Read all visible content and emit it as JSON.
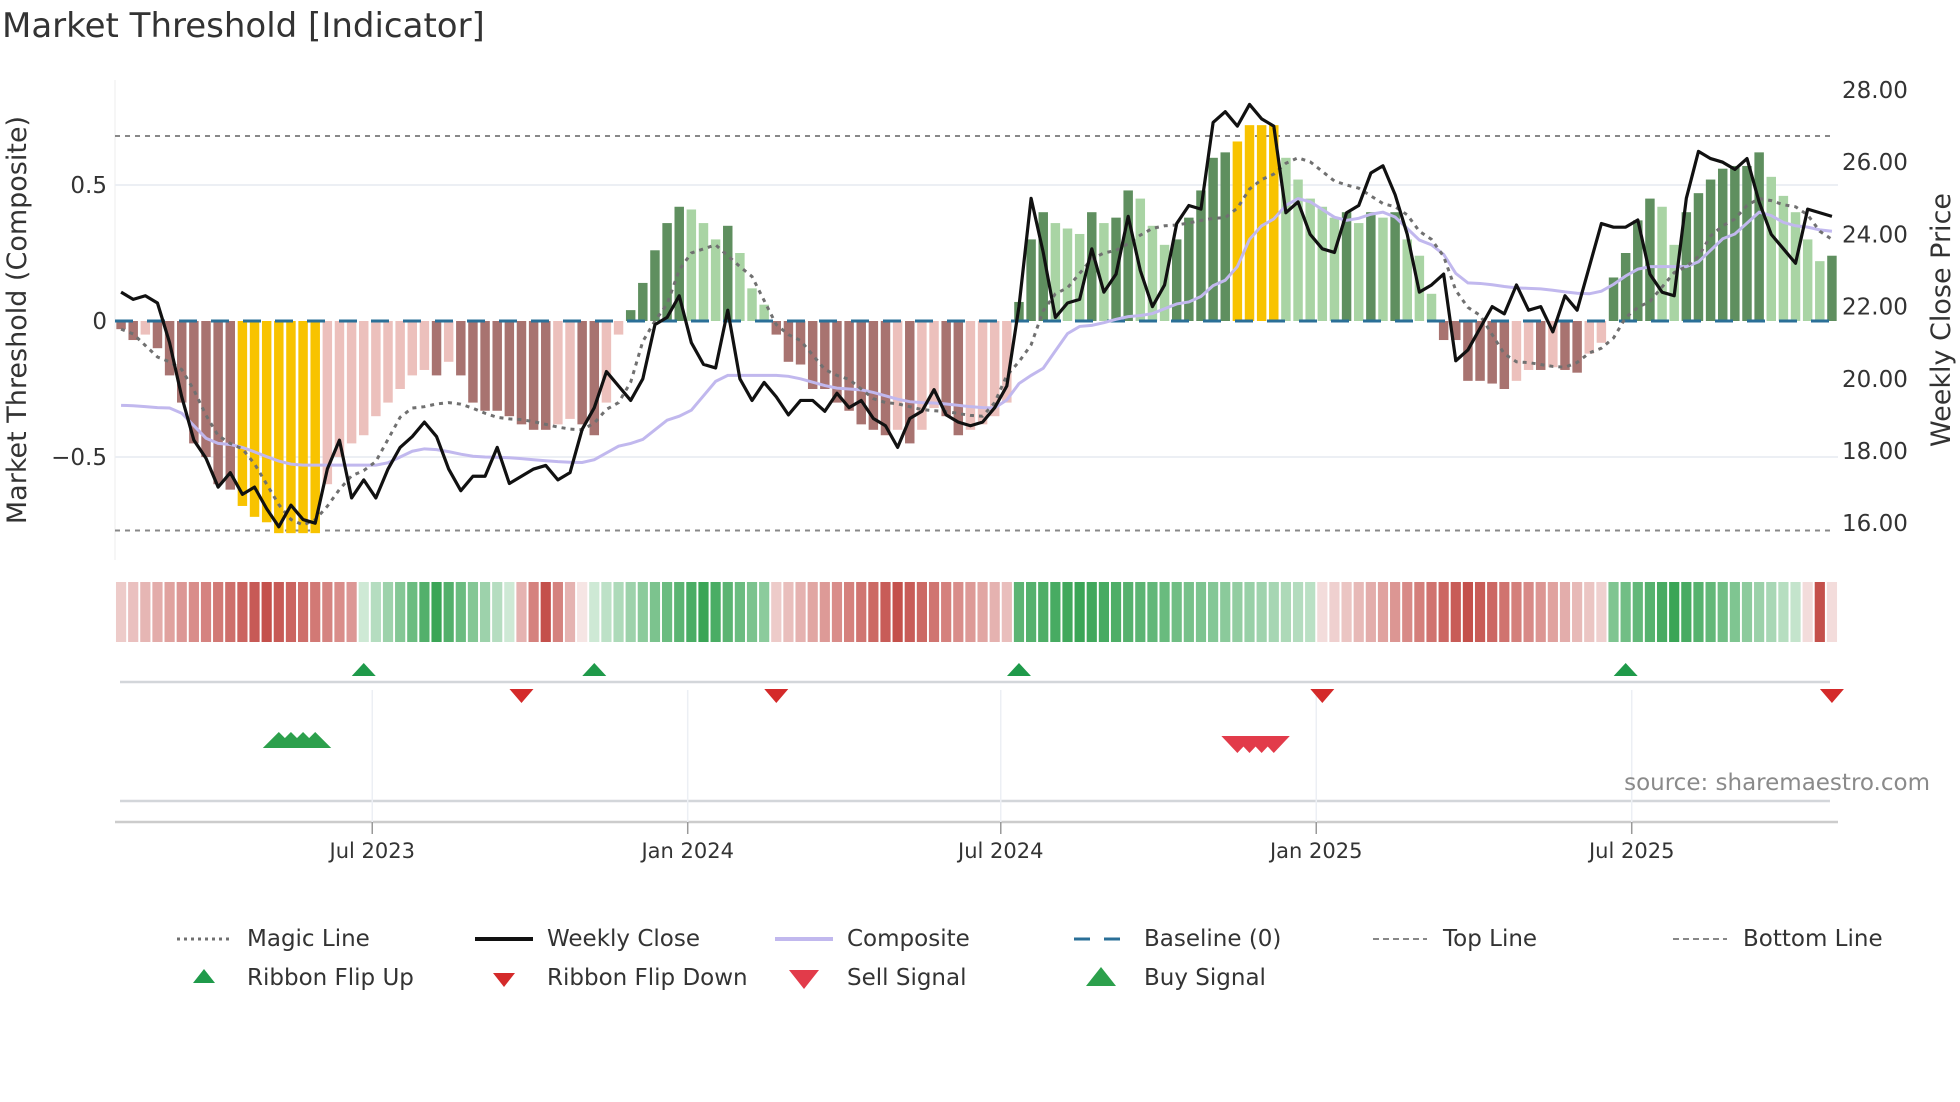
{
  "title": "Market Threshold [Indicator]",
  "source": "source: sharemaestro.com",
  "chart_data": {
    "type": "bar+line",
    "title": "Market Threshold [Indicator]",
    "ylabel_left": "Market Threshold (Composite)",
    "ylabel_right": "Weekly Close Price",
    "ylim_left": [
      -0.85,
      0.85
    ],
    "ylim_right": [
      14.9,
      29.2
    ],
    "left_ticks": [
      {
        "v": 0.5,
        "label": "0.5"
      },
      {
        "v": 0,
        "label": "0"
      },
      {
        "v": -0.5,
        "label": "−0.5"
      }
    ],
    "right_ticks": [
      {
        "v": 28,
        "label": "28.00"
      },
      {
        "v": 26,
        "label": "26.00"
      },
      {
        "v": 24,
        "label": "24.00"
      },
      {
        "v": 22,
        "label": "22.00"
      },
      {
        "v": 20,
        "label": "20.00"
      },
      {
        "v": 18,
        "label": "18.00"
      },
      {
        "v": 16,
        "label": "16.00"
      }
    ],
    "x_ticks": [
      {
        "week": 21.2,
        "label": "Jul 2023"
      },
      {
        "week": 47.2,
        "label": "Jan 2024"
      },
      {
        "week": 73.0,
        "label": "Jul 2024"
      },
      {
        "week": 99.0,
        "label": "Jan 2025"
      },
      {
        "week": 125.0,
        "label": "Jul 2025"
      }
    ],
    "top_line": 0.68,
    "bottom_line": -0.77,
    "baseline": 0,
    "extreme_threshold": 0.65,
    "composite_bars": [
      -0.03,
      -0.07,
      -0.05,
      -0.1,
      -0.2,
      -0.3,
      -0.45,
      -0.5,
      -0.6,
      -0.62,
      -0.68,
      -0.72,
      -0.74,
      -0.78,
      -0.78,
      -0.78,
      -0.78,
      -0.6,
      -0.5,
      -0.45,
      -0.42,
      -0.35,
      -0.3,
      -0.25,
      -0.2,
      -0.18,
      -0.2,
      -0.15,
      -0.2,
      -0.3,
      -0.33,
      -0.33,
      -0.35,
      -0.38,
      -0.4,
      -0.4,
      -0.38,
      -0.36,
      -0.38,
      -0.42,
      -0.3,
      -0.05,
      0.04,
      0.14,
      0.26,
      0.36,
      0.42,
      0.41,
      0.36,
      0.3,
      0.35,
      0.25,
      0.12,
      0.06,
      -0.05,
      -0.15,
      -0.16,
      -0.25,
      -0.25,
      -0.3,
      -0.33,
      -0.38,
      -0.4,
      -0.42,
      -0.4,
      -0.45,
      -0.4,
      -0.32,
      -0.35,
      -0.42,
      -0.4,
      -0.38,
      -0.35,
      -0.3,
      0.07,
      0.3,
      0.4,
      0.36,
      0.34,
      0.32,
      0.4,
      0.36,
      0.38,
      0.48,
      0.45,
      0.35,
      0.28,
      0.3,
      0.38,
      0.48,
      0.6,
      0.62,
      0.66,
      0.72,
      0.72,
      0.72,
      0.6,
      0.52,
      0.45,
      0.42,
      0.38,
      0.4,
      0.36,
      0.4,
      0.38,
      0.4,
      0.3,
      0.24,
      0.1,
      -0.07,
      -0.07,
      -0.22,
      -0.22,
      -0.23,
      -0.25,
      -0.22,
      -0.18,
      -0.18,
      -0.17,
      -0.18,
      -0.19,
      -0.12,
      -0.08,
      0.16,
      0.25,
      0.37,
      0.45,
      0.42,
      0.28,
      0.4,
      0.47,
      0.52,
      0.56,
      0.57,
      0.57,
      0.62,
      0.53,
      0.46,
      0.4,
      0.3,
      0.22,
      0.24
    ],
    "weekly_close": [
      22.4,
      22.2,
      22.3,
      22.1,
      21.0,
      19.5,
      18.3,
      17.8,
      17.0,
      17.4,
      16.8,
      17.0,
      16.4,
      15.9,
      16.5,
      16.1,
      16.0,
      17.5,
      18.3,
      16.7,
      17.2,
      16.7,
      17.5,
      18.1,
      18.4,
      18.8,
      18.4,
      17.5,
      16.9,
      17.3,
      17.3,
      18.1,
      17.1,
      17.3,
      17.5,
      17.6,
      17.2,
      17.4,
      18.6,
      19.2,
      20.2,
      19.8,
      19.4,
      20.0,
      21.5,
      21.7,
      22.3,
      21.0,
      20.4,
      20.3,
      21.9,
      20.0,
      19.4,
      19.9,
      19.5,
      19.0,
      19.4,
      19.4,
      19.1,
      19.6,
      19.2,
      19.4,
      18.9,
      18.7,
      18.1,
      18.9,
      19.1,
      19.7,
      19.0,
      18.8,
      18.7,
      18.8,
      19.2,
      19.8,
      22.0,
      25.0,
      23.5,
      21.7,
      22.1,
      22.2,
      23.6,
      22.4,
      22.9,
      24.5,
      23.0,
      22.0,
      22.6,
      24.3,
      24.8,
      24.7,
      27.1,
      27.4,
      27.0,
      27.6,
      27.2,
      27.0,
      24.6,
      24.9,
      24.0,
      23.6,
      23.5,
      24.6,
      24.8,
      25.7,
      25.9,
      25.1,
      24.0,
      22.4,
      22.6,
      22.9,
      20.5,
      20.8,
      21.4,
      22.0,
      21.8,
      22.6,
      21.9,
      22.0,
      21.3,
      22.3,
      21.9,
      23.1,
      24.3,
      24.2,
      24.2,
      24.4,
      22.9,
      22.4,
      22.3,
      25.0,
      26.3,
      26.1,
      26.0,
      25.8,
      26.1,
      24.9,
      24.0,
      23.6,
      23.2,
      24.7,
      24.6,
      24.5
    ],
    "magic_line": [
      [
        0,
        -0.03
      ],
      [
        4,
        -0.15
      ],
      [
        9,
        -0.45
      ],
      [
        15,
        -0.75
      ],
      [
        20,
        -0.55
      ],
      [
        24,
        -0.32
      ],
      [
        27,
        -0.3
      ],
      [
        32,
        -0.36
      ],
      [
        38,
        -0.4
      ],
      [
        41,
        -0.3
      ],
      [
        44,
        0.0
      ],
      [
        47,
        0.25
      ],
      [
        49,
        0.28
      ],
      [
        51,
        0.2
      ],
      [
        55,
        -0.05
      ],
      [
        59,
        -0.2
      ],
      [
        63,
        -0.3
      ],
      [
        67,
        -0.33
      ],
      [
        71,
        -0.35
      ],
      [
        74,
        -0.15
      ],
      [
        77,
        0.1
      ],
      [
        81,
        0.25
      ],
      [
        86,
        0.35
      ],
      [
        91,
        0.38
      ],
      [
        94,
        0.52
      ],
      [
        97,
        0.6
      ],
      [
        101,
        0.5
      ],
      [
        105,
        0.42
      ],
      [
        108,
        0.3
      ],
      [
        111,
        0.05
      ],
      [
        115,
        -0.15
      ],
      [
        119,
        -0.17
      ],
      [
        122,
        -0.1
      ],
      [
        125,
        0.05
      ],
      [
        129,
        0.2
      ],
      [
        132,
        0.35
      ],
      [
        135,
        0.45
      ],
      [
        138,
        0.42
      ],
      [
        141,
        0.3
      ]
    ],
    "composite_line": [
      [
        0,
        -0.31
      ],
      [
        4,
        -0.32
      ],
      [
        8,
        -0.45
      ],
      [
        15,
        -0.53
      ],
      [
        21,
        -0.53
      ],
      [
        25,
        -0.47
      ],
      [
        30,
        -0.5
      ],
      [
        38,
        -0.52
      ],
      [
        42,
        -0.45
      ],
      [
        46,
        -0.35
      ],
      [
        50,
        -0.2
      ],
      [
        54,
        -0.2
      ],
      [
        60,
        -0.25
      ],
      [
        66,
        -0.3
      ],
      [
        72,
        -0.32
      ],
      [
        75,
        -0.2
      ],
      [
        79,
        -0.02
      ],
      [
        84,
        0.02
      ],
      [
        88,
        0.07
      ],
      [
        91,
        0.15
      ],
      [
        94,
        0.35
      ],
      [
        97,
        0.45
      ],
      [
        101,
        0.37
      ],
      [
        104,
        0.4
      ],
      [
        108,
        0.28
      ],
      [
        111,
        0.14
      ],
      [
        116,
        0.12
      ],
      [
        121,
        0.1
      ],
      [
        126,
        0.2
      ],
      [
        129,
        0.2
      ],
      [
        133,
        0.32
      ],
      [
        135,
        0.4
      ],
      [
        138,
        0.35
      ],
      [
        141,
        0.33
      ]
    ],
    "ribbon_segments": [
      {
        "start": 0,
        "end": 19,
        "sign": -1,
        "peak": 12,
        "min": 0.3
      },
      {
        "start": 20,
        "end": 32,
        "sign": 1,
        "peak": 26,
        "min": 0.25
      },
      {
        "start": 33,
        "end": 38,
        "sign": -1,
        "peak": 35,
        "min": 0.15
      },
      {
        "start": 39,
        "end": 53,
        "sign": 1,
        "peak": 48,
        "min": 0.25
      },
      {
        "start": 54,
        "end": 73,
        "sign": -1,
        "peak": 64,
        "min": 0.3
      },
      {
        "start": 74,
        "end": 98,
        "sign": 1,
        "peak": 79,
        "min": 0.35
      },
      {
        "start": 99,
        "end": 122,
        "sign": -1,
        "peak": 111,
        "min": 0.2
      },
      {
        "start": 123,
        "end": 138,
        "sign": 1,
        "peak": 128,
        "min": 0.3
      },
      {
        "start": 139,
        "end": 141,
        "sign": -1,
        "peak": 140,
        "min": 0.2
      }
    ],
    "ribbon_flip_up": [
      20,
      39,
      74,
      124
    ],
    "ribbon_flip_down": [
      33,
      54,
      99,
      141
    ],
    "buy_signals": [
      13,
      14,
      15,
      16
    ],
    "sell_signals": [
      92,
      93,
      94,
      95
    ],
    "colors": {
      "bar_neg_dark": "#a87370",
      "bar_neg_light": "#ecc0bc",
      "bar_pos_dark": "#5f8f5f",
      "bar_pos_light": "#a9d4a4",
      "bar_extreme": "#f8c300",
      "close": "#111111",
      "composite": "#c1b8ee",
      "magic": "#707070",
      "baseline": "#2a6f97",
      "threshold": "#888888",
      "ribbon_red": "#c4504b",
      "ribbon_green": "#3aa556",
      "flip_up": "#1f9a4a",
      "flip_down": "#d42a2a",
      "sell": "#e23b4a",
      "buy": "#2ca04c"
    },
    "legend": [
      {
        "key": "magic",
        "label": "Magic Line"
      },
      {
        "key": "close",
        "label": "Weekly Close"
      },
      {
        "key": "composite",
        "label": "Composite"
      },
      {
        "key": "baseline",
        "label": "Baseline (0)"
      },
      {
        "key": "top",
        "label": "Top Line"
      },
      {
        "key": "bottom",
        "label": "Bottom Line"
      },
      {
        "key": "flip_up",
        "label": "Ribbon Flip Up"
      },
      {
        "key": "flip_down",
        "label": "Ribbon Flip Down"
      },
      {
        "key": "sell",
        "label": "Sell Signal"
      },
      {
        "key": "buy",
        "label": "Buy Signal"
      }
    ]
  }
}
